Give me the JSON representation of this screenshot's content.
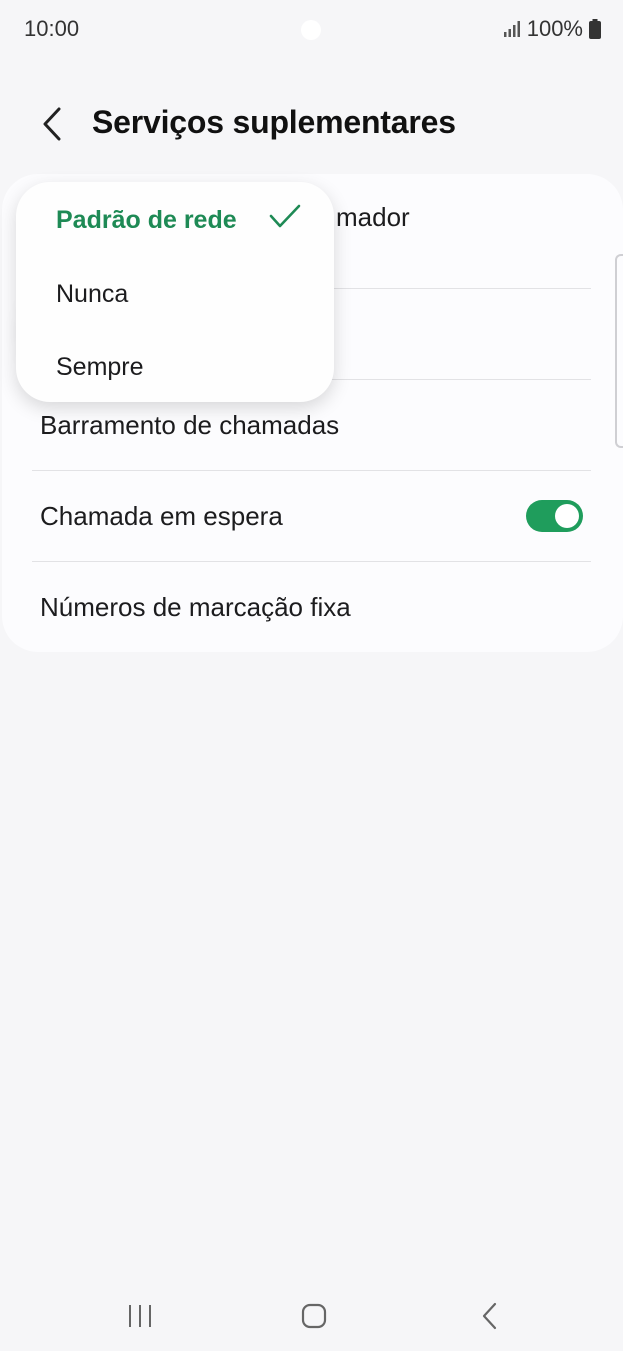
{
  "status_bar": {
    "time": "10:00",
    "battery": "100%",
    "icons": [
      "signal-icon",
      "battery-icon"
    ]
  },
  "header": {
    "back_icon": "chevron-left-icon",
    "title": "Serviços suplementares"
  },
  "settings": {
    "items": [
      {
        "label": "Identificação do chamador"
      },
      {
        "label": ""
      },
      {
        "label": "Barramento de chamadas"
      },
      {
        "label": "Chamada em espera",
        "toggle": true
      },
      {
        "label": "Números de marcação fixa"
      }
    ],
    "caller_id_partial": "mador"
  },
  "dropdown": {
    "options": [
      {
        "label": "Padrão de rede",
        "selected": true
      },
      {
        "label": "Nunca",
        "selected": false
      },
      {
        "label": "Sempre",
        "selected": false
      }
    ],
    "check_icon": "checkmark-icon"
  },
  "nav_bar": {
    "icons": [
      "recent-apps-icon",
      "home-icon",
      "back-icon"
    ]
  },
  "colors": {
    "accent": "#1e8a55",
    "toggle_on": "#1f9d5c",
    "background": "#f6f6f8"
  }
}
